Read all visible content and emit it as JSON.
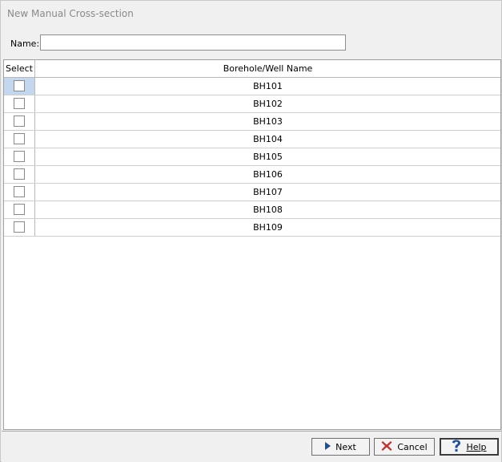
{
  "window": {
    "title": "New Manual Cross-section"
  },
  "form": {
    "name_label": "Name:",
    "name_value": ""
  },
  "grid": {
    "columns": {
      "select": "Select",
      "name": "Borehole/Well Name"
    },
    "rows": [
      {
        "checked": false,
        "name": "BH101"
      },
      {
        "checked": false,
        "name": "BH102"
      },
      {
        "checked": false,
        "name": "BH103"
      },
      {
        "checked": false,
        "name": "BH104"
      },
      {
        "checked": false,
        "name": "BH105"
      },
      {
        "checked": false,
        "name": "BH106"
      },
      {
        "checked": false,
        "name": "BH107"
      },
      {
        "checked": false,
        "name": "BH108"
      },
      {
        "checked": false,
        "name": "BH109"
      }
    ]
  },
  "buttons": {
    "next": {
      "label": "Next",
      "icon": "play-triangle-icon",
      "color": "#1e4f8f"
    },
    "cancel": {
      "label": "Cancel",
      "icon": "red-x-icon",
      "color": "#c0312f"
    },
    "help": {
      "label": "Help",
      "icon": "blue-question-icon",
      "color": "#1f4f9f"
    }
  }
}
